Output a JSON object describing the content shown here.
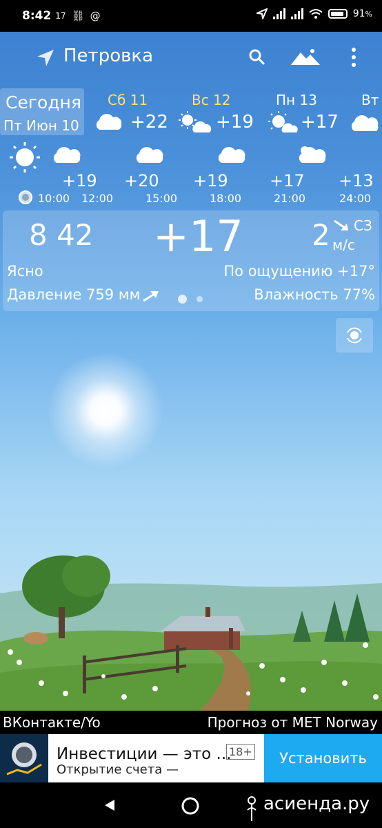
{
  "status_bar": {
    "time": "8:42",
    "small_label": "17",
    "link_glyph": "⛓",
    "at_glyph": "@",
    "battery": "91"
  },
  "app_bar": {
    "location": "Петровка"
  },
  "days": [
    {
      "name": "Сегодня",
      "date": "Пт Июн 10"
    },
    {
      "name": "Сб 11",
      "temp": "+22"
    },
    {
      "name": "Вс 12",
      "temp": "+19"
    },
    {
      "name": "Пн 13",
      "temp": "+17"
    },
    {
      "name": "Вт"
    }
  ],
  "hourly": {
    "temps": [
      "+19",
      "+20",
      "+19",
      "+17",
      "+13"
    ],
    "times": [
      "10:00",
      "12:00",
      "15:00",
      "18:00",
      "21:00",
      "24:00"
    ]
  },
  "current": {
    "clock": "8 42",
    "temp": "+17",
    "wind_speed": "2",
    "wind_dir": "СЗ",
    "wind_unit": "м/с",
    "condition": "Ясно",
    "feels_like": "По ощущению +17°",
    "pressure": "Давление 759 мм",
    "humidity": "Влажность 77%"
  },
  "credits": {
    "left": "ВКонтакте/Yo",
    "right": "Прогноз от MET Norway"
  },
  "ad": {
    "title": "Инвестиции — это ...",
    "subtitle": "Открытие счета —",
    "age": "18+",
    "install": "Установить"
  },
  "watermark": "асиенда.ру",
  "colors": {
    "sky_top": "#3a7fcf",
    "yellow_day": "#ffe372",
    "install_blue": "#1daaf0"
  }
}
